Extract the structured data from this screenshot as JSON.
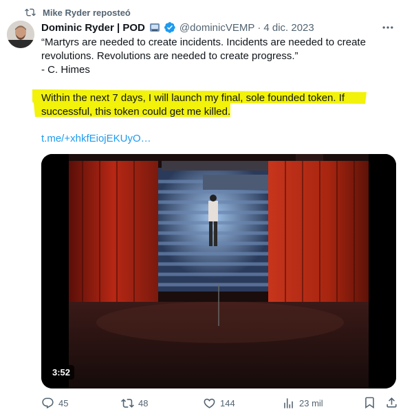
{
  "repost": {
    "icon": "repost-icon",
    "text": "Mike Ryder reposteó"
  },
  "author": {
    "name": "Dominic Ryder | POD",
    "badge_emoji": "pod-emoji-icon",
    "verified": "verified-badge-icon",
    "handle": "@dominicVEMP",
    "separator": "·",
    "date": "4 dic. 2023"
  },
  "tweet": {
    "quote_lines": [
      "“Martyrs are needed to create incidents. Incidents are needed to create",
      "revolutions. Revolutions are needed to create progress.”",
      "- C. Himes"
    ],
    "highlight_lines": [
      "Within the next 7 days, I will launch my final, sole founded token. If",
      "successful, this token could get me killed."
    ],
    "link": "t.me/+xhkfEiojEKUyO…"
  },
  "media": {
    "duration": "3:52"
  },
  "actions": {
    "replies": "45",
    "reposts": "48",
    "likes": "144",
    "views": "23 mil"
  },
  "colors": {
    "accent": "#1d9bf0",
    "secondary_text": "#536471",
    "highlight": "#f2f20a",
    "primary_text": "#0f1419"
  }
}
